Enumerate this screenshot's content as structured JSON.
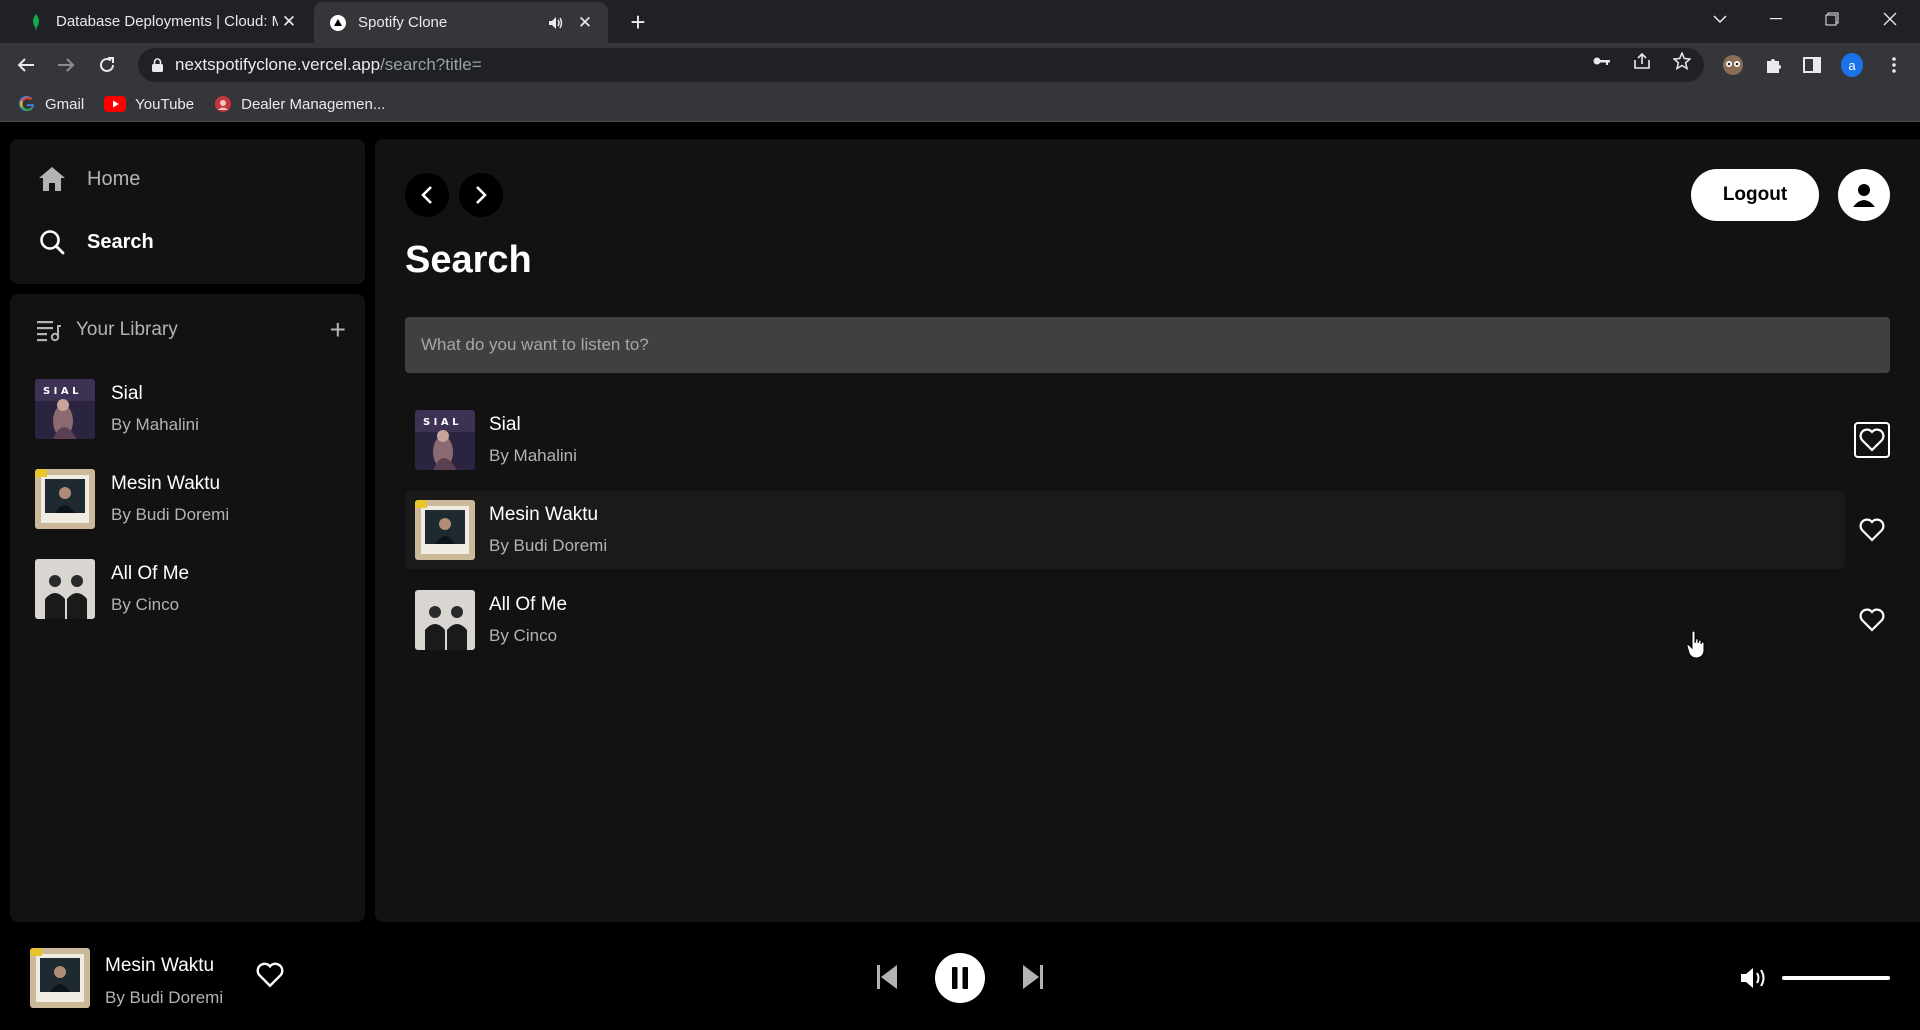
{
  "browser": {
    "tabs": [
      {
        "title": "Database Deployments | Cloud: M",
        "icon": "mongodb-leaf-icon",
        "active": false
      },
      {
        "title": "Spotify Clone",
        "icon": "vercel-triangle-icon",
        "active": true,
        "audio_icon": "speaker-icon"
      }
    ],
    "url_host": "nextspotifyclone.vercel.app",
    "url_path": "/search?title=",
    "profile_initial": "a",
    "bookmarks": [
      {
        "label": "Gmail",
        "icon": "google-icon"
      },
      {
        "label": "YouTube",
        "icon": "youtube-icon"
      },
      {
        "label": "Dealer Managemen...",
        "icon": "dealer-icon"
      }
    ]
  },
  "sidebar": {
    "nav": [
      {
        "label": "Home",
        "icon": "home-icon"
      },
      {
        "label": "Search",
        "icon": "search-icon"
      }
    ],
    "library_title": "Your Library",
    "library_items": [
      {
        "title": "Sial",
        "subtitle": "By Mahalini"
      },
      {
        "title": "Mesin Waktu",
        "subtitle": "By Budi Doremi"
      },
      {
        "title": "All Of Me",
        "subtitle": "By Cinco"
      }
    ]
  },
  "header": {
    "logout_label": "Logout",
    "page_title": "Search",
    "search_placeholder": "What do you want to listen to?",
    "search_value": ""
  },
  "results": [
    {
      "title": "Sial",
      "subtitle": "By Mahalini"
    },
    {
      "title": "Mesin Waktu",
      "subtitle": "By Budi Doremi"
    },
    {
      "title": "All Of Me",
      "subtitle": "By Cinco"
    }
  ],
  "player": {
    "title": "Mesin Waktu",
    "subtitle": "By Budi Doremi",
    "state": "playing",
    "volume": 1.0
  },
  "colors": {
    "background": "#000000",
    "panel": "#121212",
    "input": "#404040",
    "muted_text": "#b3b3b3"
  }
}
